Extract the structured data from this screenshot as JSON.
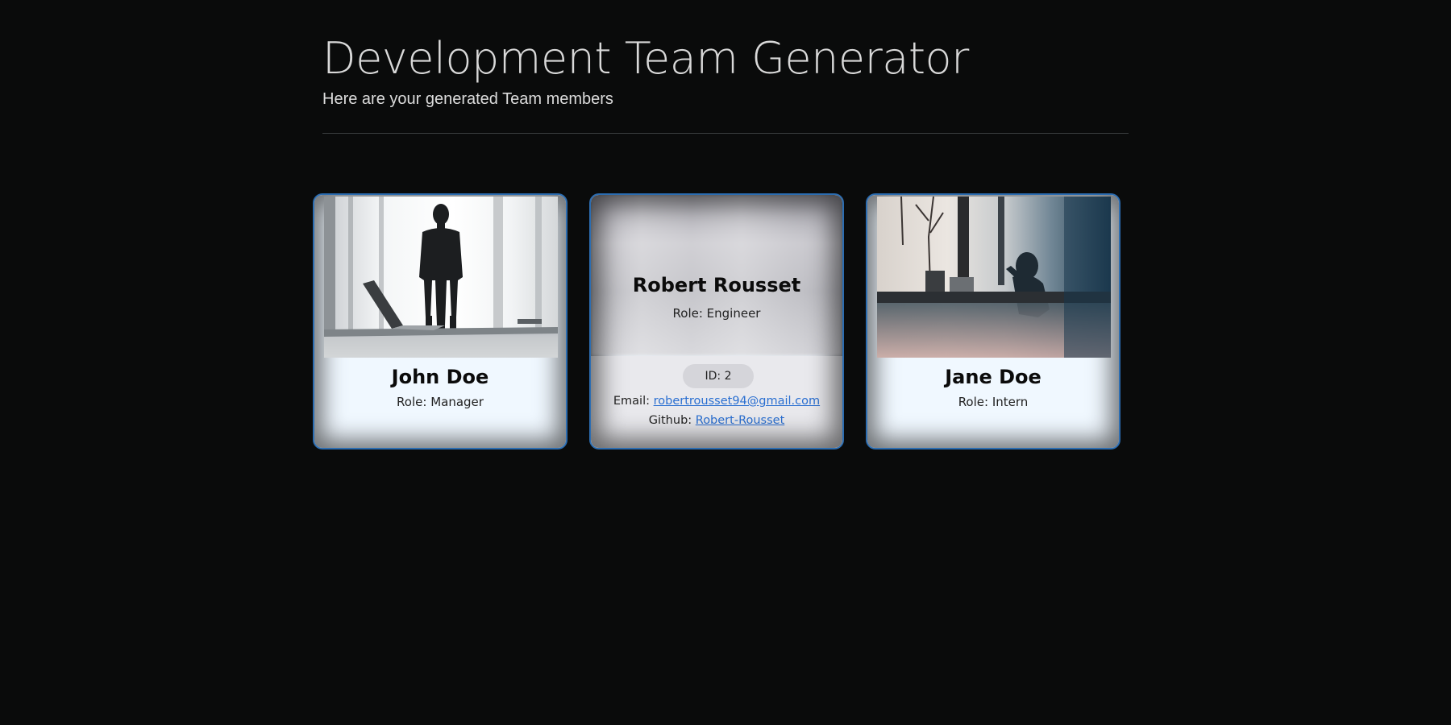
{
  "header": {
    "title": "Development Team Generator",
    "subtitle": "Here are your generated Team members"
  },
  "cards": [
    {
      "name": "John Doe",
      "role": "Role: Manager",
      "photo": "silhouette-man-office-window"
    },
    {
      "name": "Robert Rousset",
      "role": "Role: Engineer",
      "id_label": "ID: 2",
      "email_label": "Email: ",
      "email": "robertrousset94@gmail.com",
      "github_label": "Github: ",
      "github": "Robert-Rousset"
    },
    {
      "name": "Jane Doe",
      "role": "Role: Intern",
      "photo": "silhouette-person-cafe-window"
    }
  ],
  "colors": {
    "background": "#0a0b0b",
    "card_border": "#2c6db1",
    "card_background": "#f0f8ff",
    "link": "#2a6fd1"
  }
}
